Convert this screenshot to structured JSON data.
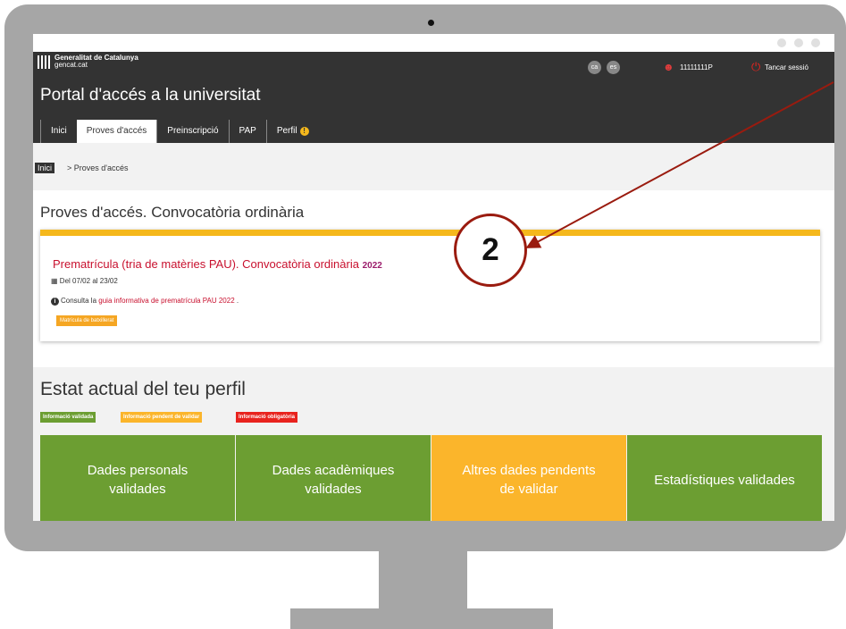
{
  "header": {
    "gencat_name": "Generalitat de Catalunya",
    "gencat_site": "gencat.cat",
    "lang_ca": "ca",
    "lang_es": "es",
    "user_id": "11111111P",
    "logout_label": "Tancar sessió",
    "portal_title": "Portal d'accés a la universitat"
  },
  "nav": {
    "tabs": [
      {
        "label": "Inici"
      },
      {
        "label": "Proves d'accés"
      },
      {
        "label": "Preinscripció"
      },
      {
        "label": "PAP"
      },
      {
        "label": "Perfil"
      }
    ],
    "active_tab": "Proves d'accés"
  },
  "breadcrumb": {
    "home": "Inici",
    "current": "> Proves d'accés"
  },
  "section_title": "Proves d'accés. Convocatòria ordinària",
  "card": {
    "title": "Prematrícula (tria de matèries PAU). Convocatòria ordinària",
    "year": "2022",
    "dates_prefix": "Del",
    "date_from": "07/02",
    "dates_mid": "al",
    "date_to": "23/02",
    "info_prefix": "Consulta la",
    "info_link": "guia informativa de prematrícula PAU",
    "info_year": "2022",
    "info_suffix": ".",
    "badge": "Matrícula de batxillerat"
  },
  "profile": {
    "title": "Estat actual del teu perfil",
    "legend": [
      {
        "label": "Informació validada",
        "color": "#6c9e32"
      },
      {
        "label": "Informació pendent de validar",
        "color": "#fbb52b"
      },
      {
        "label": "Informació obligatòria",
        "color": "#e8231e"
      }
    ],
    "boxes": [
      {
        "label": "Dades personals validades",
        "status": "validated"
      },
      {
        "label": "Dades acadèmiques validades",
        "status": "validated"
      },
      {
        "label": "Altres dades pendents de validar",
        "status": "pending"
      },
      {
        "label": "Estadístiques validades",
        "status": "validated"
      }
    ]
  },
  "annotation": {
    "step_number": "2"
  },
  "colors": {
    "header_bg": "#333333",
    "accent_red": "#c8102e",
    "warning_yellow": "#f5b81c",
    "validated_green": "#6c9e32",
    "pending_orange": "#fbb52b",
    "annotation_red": "#9a1b0f"
  },
  "icons": {
    "warning": "warning-icon",
    "calendar": "calendar-icon",
    "info": "info-icon",
    "user": "user-icon",
    "power": "power-icon"
  }
}
